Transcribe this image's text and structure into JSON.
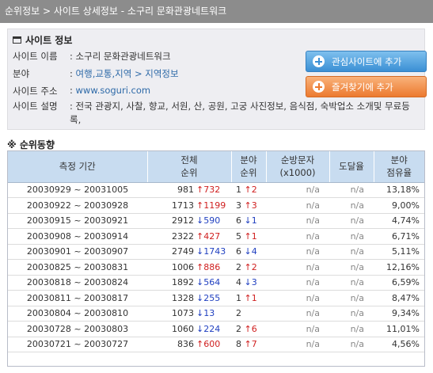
{
  "breadcrumb": "순위정보 > 사이트 상세정보 - 소구리 문화관광네트워크",
  "info": {
    "heading": "사이트 정보",
    "fields": {
      "name_label": "사이트 이름",
      "name_value": ": 소구리 문화관광네트워크",
      "category_label": "분야",
      "category_prefix": ": ",
      "category_link": "여행,교통,지역 > 지역정보",
      "address_label": "사이트 주소",
      "address_prefix": ": ",
      "address_link": "www.soguri.com",
      "desc_label": "사이트 설명",
      "desc_value": ": 전국 관광지, 사찰, 향교, 서원, 산, 공원, 고궁 사진정보, 음식점, 숙박업소 소개및 무료등록,"
    },
    "buttons": {
      "favorite_site": "관심사이트에 추가",
      "bookmark": "즐겨찾기에 추가"
    }
  },
  "ranking": {
    "heading": "※ 순위동향",
    "columns": [
      "측정 기간",
      "전체\n순위",
      "분야\n순위",
      "순방문자\n(x1000)",
      "도달율",
      "분야\n점유율"
    ],
    "rows": [
      {
        "period": "20030929 ~ 20031005",
        "total": "981",
        "total_change": "↑732",
        "total_dir": "up",
        "cat": "1",
        "cat_change": "↑2",
        "cat_dir": "up",
        "visitors": "n/a",
        "reach": "n/a",
        "share": "13,18%"
      },
      {
        "period": "20030922 ~ 20030928",
        "total": "1713",
        "total_change": "↑1199",
        "total_dir": "up",
        "cat": "3",
        "cat_change": "↑3",
        "cat_dir": "up",
        "visitors": "n/a",
        "reach": "n/a",
        "share": "9,00%"
      },
      {
        "period": "20030915 ~ 20030921",
        "total": "2912",
        "total_change": "↓590",
        "total_dir": "down",
        "cat": "6",
        "cat_change": "↓1",
        "cat_dir": "down",
        "visitors": "n/a",
        "reach": "n/a",
        "share": "4,74%"
      },
      {
        "period": "20030908 ~ 20030914",
        "total": "2322",
        "total_change": "↑427",
        "total_dir": "up",
        "cat": "5",
        "cat_change": "↑1",
        "cat_dir": "up",
        "visitors": "n/a",
        "reach": "n/a",
        "share": "6,71%"
      },
      {
        "period": "20030901 ~ 20030907",
        "total": "2749",
        "total_change": "↓1743",
        "total_dir": "down",
        "cat": "6",
        "cat_change": "↓4",
        "cat_dir": "down",
        "visitors": "n/a",
        "reach": "n/a",
        "share": "5,11%"
      },
      {
        "period": "20030825 ~ 20030831",
        "total": "1006",
        "total_change": "↑886",
        "total_dir": "up",
        "cat": "2",
        "cat_change": "↑2",
        "cat_dir": "up",
        "visitors": "n/a",
        "reach": "n/a",
        "share": "12,16%"
      },
      {
        "period": "20030818 ~ 20030824",
        "total": "1892",
        "total_change": "↓564",
        "total_dir": "down",
        "cat": "4",
        "cat_change": "↓3",
        "cat_dir": "down",
        "visitors": "n/a",
        "reach": "n/a",
        "share": "6,59%"
      },
      {
        "period": "20030811 ~ 20030817",
        "total": "1328",
        "total_change": "↓255",
        "total_dir": "down",
        "cat": "1",
        "cat_change": "↑1",
        "cat_dir": "up",
        "visitors": "n/a",
        "reach": "n/a",
        "share": "8,47%"
      },
      {
        "period": "20030804 ~ 20030810",
        "total": "1073",
        "total_change": "↓13",
        "total_dir": "down",
        "cat": "2",
        "cat_change": "",
        "cat_dir": "",
        "visitors": "n/a",
        "reach": "n/a",
        "share": "9,34%"
      },
      {
        "period": "20030728 ~ 20030803",
        "total": "1060",
        "total_change": "↓224",
        "total_dir": "down",
        "cat": "2",
        "cat_change": "↑6",
        "cat_dir": "up",
        "visitors": "n/a",
        "reach": "n/a",
        "share": "11,01%"
      },
      {
        "period": "20030721 ~ 20030727",
        "total": "836",
        "total_change": "↑600",
        "total_dir": "up",
        "cat": "8",
        "cat_change": "↑7",
        "cat_dir": "up",
        "visitors": "n/a",
        "reach": "n/a",
        "share": "4,56%"
      }
    ]
  },
  "colors": {
    "up": "#d02020",
    "down": "#2040c0",
    "header_bg": "#c8dcf0",
    "titlebar_bg": "#8c8c8c"
  }
}
